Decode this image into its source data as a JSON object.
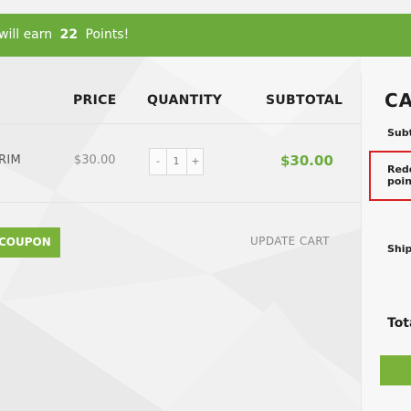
{
  "notice": {
    "prefix": "will earn",
    "points": "22",
    "suffix": "Points!"
  },
  "cart_table": {
    "headers": [
      "PRICE",
      "QUANTITY",
      "SUBTOTAL"
    ],
    "rows": [
      {
        "product": "RIM",
        "price": "$30.00",
        "quantity": "1",
        "subtotal": "$30.00"
      }
    ],
    "stepper": {
      "minus": "-",
      "plus": "+"
    }
  },
  "actions": {
    "apply_coupon": "COUPON",
    "update_cart": "UPDATE CART"
  },
  "cart_totals": {
    "title": "CA",
    "subtotal_label": "Subt",
    "redeem_line1": "Rede",
    "redeem_line2": "poin",
    "shipping_label": "Ship",
    "total_label": "Tota"
  },
  "colors": {
    "accent_green": "#6aab3c",
    "button_green": "#7bb33a",
    "highlight_red": "#d92020"
  }
}
